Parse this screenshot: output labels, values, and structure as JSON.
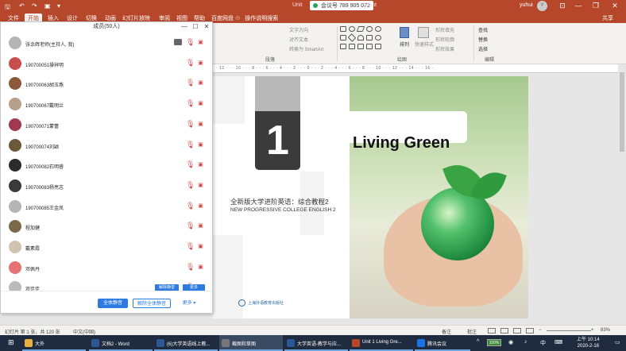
{
  "titlebar": {
    "doc_title": "Unit",
    "meeting_id": "会议号 789 905 072",
    "suffix": "Point",
    "user": "yuhui",
    "user_avatar": "Y",
    "minimize": "—",
    "restore": "❐",
    "close": "✕",
    "qa_save": "🖫",
    "qa_undo": "↶",
    "qa_redo": "↷",
    "qa_present": "▣",
    "qa_more": "▾",
    "ribbon_toggle": "⊡"
  },
  "tabs": {
    "items": [
      "文件",
      "开始",
      "插入",
      "设计",
      "切换",
      "动画",
      "幻灯片放映",
      "审阅",
      "视图",
      "帮助",
      "百度网盘"
    ],
    "active": "开始",
    "tell_me": "操作说明搜索",
    "share": "共享"
  },
  "ribbon": {
    "paragraph_label": "段落",
    "drawing_label": "绘图",
    "editing_label": "编辑",
    "text_direction": "文字方向",
    "align_text": "对齐文本",
    "smartart": "转换为 SmartArt",
    "arrange": "排列",
    "quick_styles": "快速样式",
    "shape_fill": "形状填充",
    "shape_outline": "形状轮廓",
    "shape_effects": "形状效果",
    "find": "查找",
    "replace": "替换",
    "select": "选择"
  },
  "ruler": {
    "text": "· 12 · · · 10 · · · 8 · · · 6 · · · 4 · · · 2 · · · 0 · · · 2 · · · 4 · · · 6 · · · 8 · · · 10 · · · 12 · · · 14 · · · 16 ·"
  },
  "slide": {
    "number": "1",
    "title": "Living Green",
    "subtitle_cn": "全新版大学进阶英语：综合教程2",
    "subtitle_en": "NEW PROGRESSIVE COLLEGE ENGLISH 2",
    "publisher": "上海外语教育出版社"
  },
  "panel": {
    "title": "成员(50人)",
    "minimize": "—",
    "maximize": "☐",
    "close": "✕",
    "members": [
      {
        "name": "张余辉老师(主持人, 我)",
        "screen": true,
        "avatar_color": "#b5b5b5"
      },
      {
        "name": "190700051操祥明",
        "avatar_color": "#c84d4d"
      },
      {
        "name": "190700063胡玉燕",
        "avatar_color": "#8a5a3c"
      },
      {
        "name": "190700067戴明兰",
        "avatar_color": "#b7a08a"
      },
      {
        "name": "190700071蒙蕾",
        "avatar_color": "#a0384f"
      },
      {
        "name": "190700074刘颖",
        "avatar_color": "#6b5a3a"
      },
      {
        "name": "190700082石明睿",
        "avatar_color": "#2b2b2b"
      },
      {
        "name": "190700083杨亮志",
        "avatar_color": "#3a3a3a"
      },
      {
        "name": "190700085王金凤",
        "avatar_color": "#b5b5b5"
      },
      {
        "name": "程加健",
        "avatar_color": "#7a6a4a"
      },
      {
        "name": "戴素霞",
        "avatar_color": "#d0c4b0"
      },
      {
        "name": "邓佩丹",
        "avatar_color": "#e57373"
      },
      {
        "name": "邓佳佳",
        "avatar_color": "#bbbbbb"
      }
    ],
    "peek_buttons": [
      "解除静音",
      "更多"
    ],
    "btn_mute_all": "全体静音",
    "btn_unmute_all": "解除全体静音",
    "btn_more": "更多 ▾"
  },
  "status": {
    "slide_info": "幻灯片 第 1 张，共 120 张",
    "language": "中文(中国)",
    "notes": "备注",
    "comments": "批注",
    "zoom": "83%",
    "zoom_minus": "−",
    "zoom_plus": "+"
  },
  "taskbar": {
    "start": "⊞",
    "items": [
      {
        "label": "大外",
        "color": "#e6b43c"
      },
      {
        "label": "文档2 - Word",
        "color": "#2b5797"
      },
      {
        "label": "(6)大学英语线上教...",
        "color": "#2b5797"
      },
      {
        "label": "截图和草图",
        "color": "#444444"
      },
      {
        "label": "大学英语-教学与应...",
        "color": "#2b5797"
      },
      {
        "label": "Unit 1 Living Gre...",
        "color": "#b7472a"
      },
      {
        "label": "腾讯会议",
        "color": "#1a73e8"
      }
    ],
    "battery": "100%",
    "ime": "中",
    "time": "上午 10:14",
    "date": "2020-2-18"
  }
}
